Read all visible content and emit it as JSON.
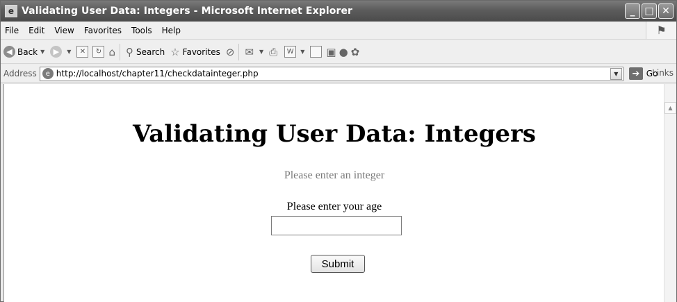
{
  "window": {
    "title": "Validating User Data: Integers - Microsoft Internet Explorer"
  },
  "menu": [
    "File",
    "Edit",
    "View",
    "Favorites",
    "Tools",
    "Help"
  ],
  "toolbar": {
    "back_label": "Back",
    "search_label": "Search",
    "favorites_label": "Favorites"
  },
  "address": {
    "label": "Address",
    "url": "http://localhost/chapter11/checkdatainteger.php",
    "go_label": "Go",
    "links_label": "Links"
  },
  "page": {
    "heading": "Validating User Data: Integers",
    "message": "Please enter an integer",
    "age_label": "Please enter your age",
    "age_value": "",
    "submit_label": "Submit"
  }
}
